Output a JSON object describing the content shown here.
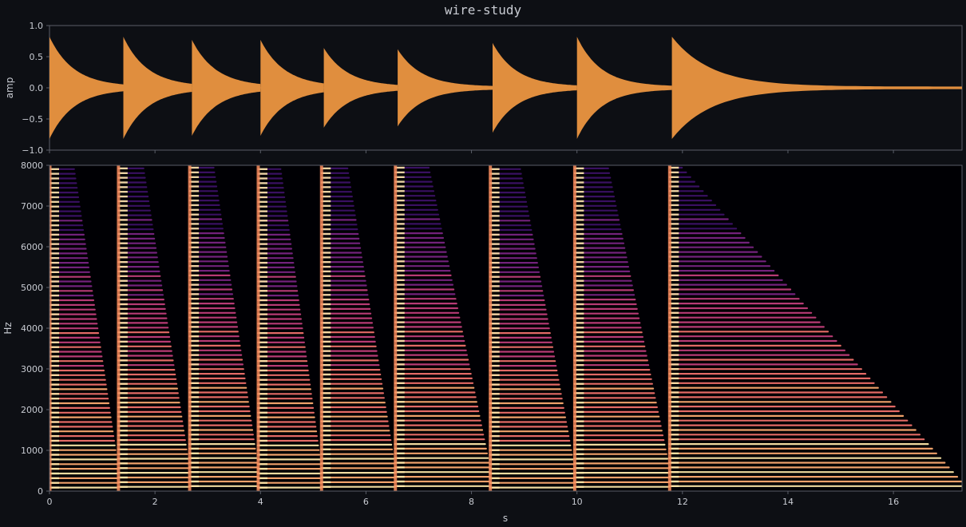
{
  "chart_data": [
    {
      "type": "area",
      "title": "wire-study",
      "xlabel": "",
      "ylabel": "amp",
      "xlim": [
        0,
        17.3
      ],
      "ylim": [
        -1.0,
        1.0
      ],
      "yticks": [
        1.0,
        0.5,
        0.0,
        -0.5,
        -1.0
      ],
      "ytick_labels": [
        "1.0",
        "0.5",
        "0.0",
        "−0.5",
        "−1.0"
      ],
      "grid": false,
      "series": [
        {
          "onsets_s": [
            0.0,
            1.4,
            2.7,
            4.0,
            5.2,
            6.6,
            8.4,
            10.0,
            11.8
          ],
          "peak_amp": [
            0.8,
            0.8,
            0.75,
            0.75,
            0.62,
            0.6,
            0.7,
            0.8,
            0.8
          ],
          "color": "#e08e3e"
        }
      ]
    },
    {
      "type": "heatmap",
      "xlabel": "s",
      "ylabel": "Hz",
      "xlim": [
        0,
        17.3
      ],
      "ylim": [
        0,
        8000
      ],
      "xticks": [
        0,
        2,
        4,
        6,
        8,
        10,
        12,
        14,
        16
      ],
      "xtick_labels": [
        "0",
        "2",
        "4",
        "6",
        "8",
        "10",
        "12",
        "14",
        "16"
      ],
      "yticks": [
        0,
        1000,
        2000,
        3000,
        4000,
        5000,
        6000,
        7000,
        8000
      ],
      "ytick_labels": [
        "0",
        "1000",
        "2000",
        "3000",
        "4000",
        "5000",
        "6000",
        "7000",
        "8000"
      ],
      "colormap": "magma",
      "grid": false,
      "onsets_s": [
        0.0,
        1.3,
        2.65,
        3.95,
        5.15,
        6.55,
        8.35,
        9.95,
        11.75
      ],
      "harmonic_spacing_hz": 115,
      "harmonic_upper_hz": 8000
    }
  ],
  "colors": {
    "background": "#0d0f14",
    "plot_background": "#000004",
    "axis": "#5a5e68",
    "text": "#c8cbd2",
    "waveform": "#e08e3e"
  }
}
